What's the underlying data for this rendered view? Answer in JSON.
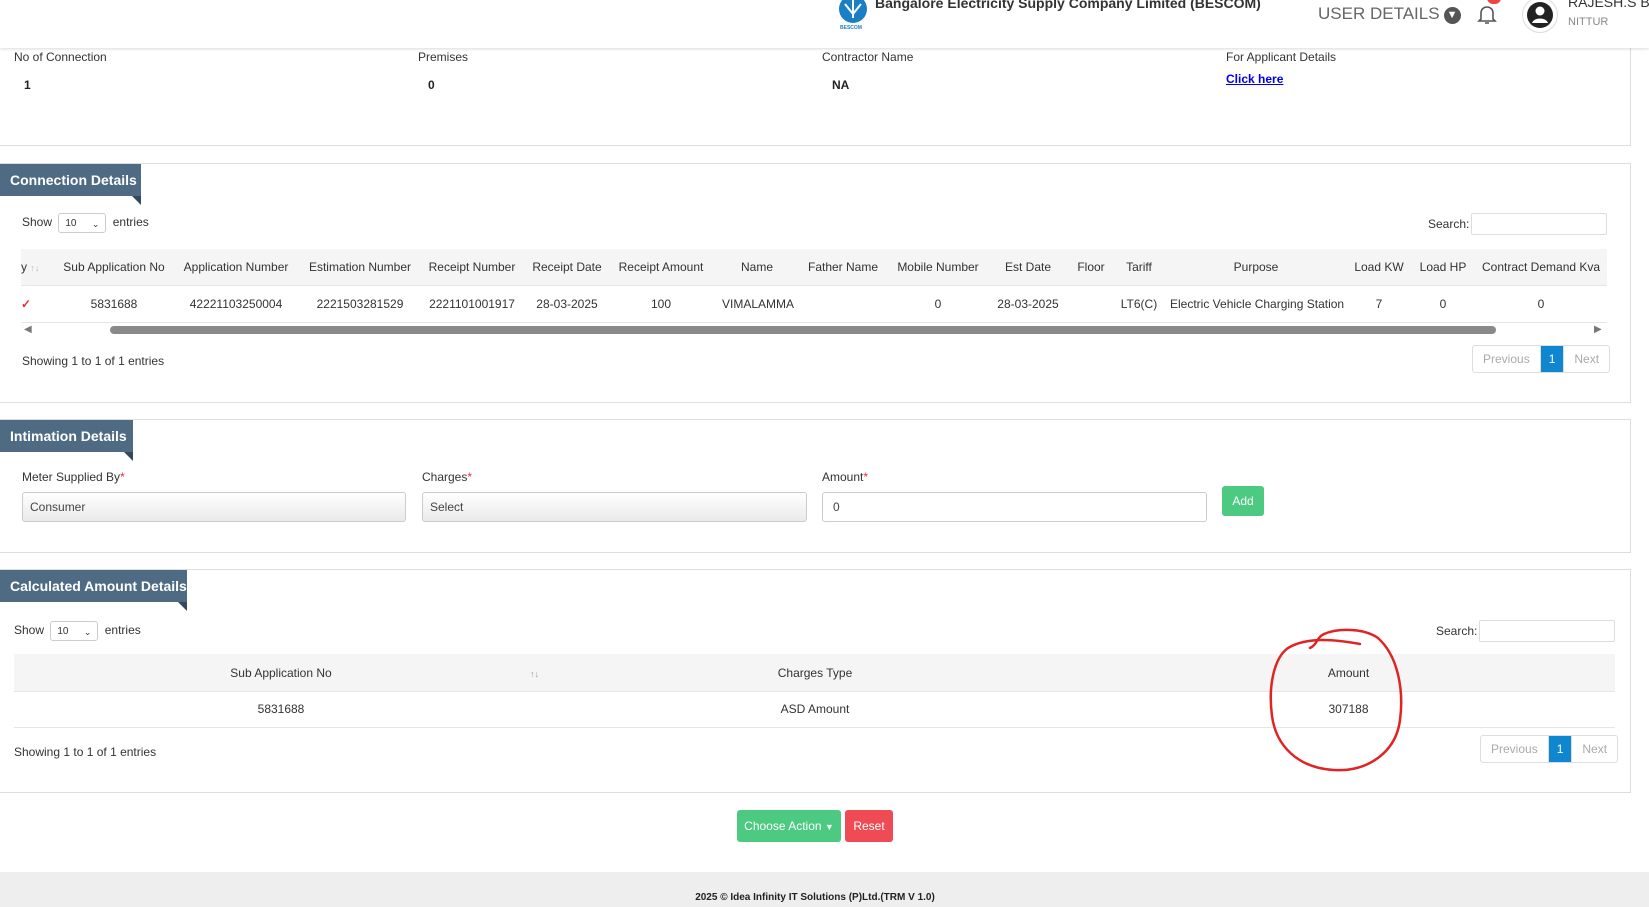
{
  "header": {
    "company": "Bangalore Electricity Supply Company Limited (BESCOM)",
    "logo_text": "BESCOM",
    "user_details_label": "USER DETAILS",
    "user_name": "RAJESH.S B",
    "user_location": "NITTUR"
  },
  "summary": {
    "items": [
      {
        "label": "No of Connection",
        "value": "1"
      },
      {
        "label": "Premises",
        "value": "0"
      },
      {
        "label": "Contractor Name",
        "value": "NA"
      },
      {
        "label": "For Applicant Details",
        "link": "Click here"
      }
    ]
  },
  "connection": {
    "title": "Connection Details",
    "show": "Show",
    "entries_value": "10",
    "entries": "entries",
    "search_label": "Search:",
    "columns": [
      "y",
      "Sub Application No",
      "Application Number",
      "Estimation Number",
      "Receipt Number",
      "Receipt Date",
      "Receipt Amount",
      "Name",
      "Father Name",
      "Mobile Number",
      "Est Date",
      "Floor",
      "Tariff",
      "Purpose",
      "Load KW",
      "Load HP",
      "Contract Demand Kva"
    ],
    "row": [
      "5831688",
      "42221103250004",
      "2221503281529",
      "2221101001917",
      "28-03-2025",
      "100",
      "VIMALAMMA",
      "",
      "0",
      "28-03-2025",
      "",
      "LT6(C)",
      "Electric Vehicle Charging Station",
      "7",
      "0",
      "0"
    ],
    "showing": "Showing 1 to 1 of 1 entries",
    "prev": "Previous",
    "page": "1",
    "next": "Next"
  },
  "intimation": {
    "title": "Intimation Details",
    "meter_label": "Meter Supplied By",
    "meter_value": "Consumer",
    "charges_label": "Charges",
    "charges_value": "Select",
    "amount_label": "Amount",
    "amount_value": "0",
    "add": "Add"
  },
  "calculated": {
    "title": "Calculated Amount Details",
    "show": "Show",
    "entries_value": "10",
    "entries": "entries",
    "search_label": "Search:",
    "columns": [
      "Sub Application No",
      "Charges Type",
      "Amount"
    ],
    "row": [
      "5831688",
      "ASD Amount",
      "307188"
    ],
    "showing": "Showing 1 to 1 of 1 entries",
    "prev": "Previous",
    "page": "1",
    "next": "Next"
  },
  "actions": {
    "choose": "Choose Action",
    "reset": "Reset"
  },
  "footer": {
    "text": "2025 © Idea Infinity IT Solutions (P)Ltd.(TRM V 1.0)"
  },
  "colors": {
    "panel_title": "#4f6b84",
    "primary": "#0f86d0",
    "success": "#4cca82",
    "danger": "#ef4b55",
    "annotation": "#e02424"
  }
}
